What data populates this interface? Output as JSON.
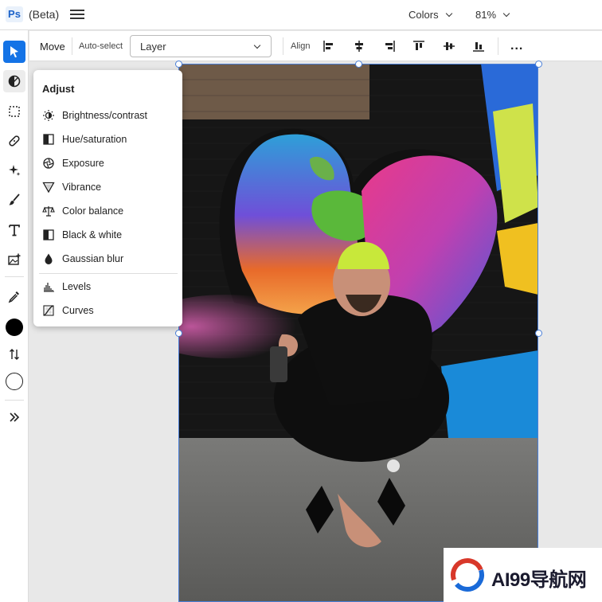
{
  "app": {
    "logo": "Ps",
    "channel": "(Beta)",
    "color_mode_dropdown": "Colors",
    "zoom_dropdown": "81%"
  },
  "toolbar_left": {
    "tools": [
      {
        "name": "move-tool-icon",
        "active": true
      },
      {
        "name": "adjustment-tool-icon",
        "active": false
      },
      {
        "name": "marquee-tool-icon",
        "active": false
      },
      {
        "name": "spot-healing-tool-icon",
        "active": false
      },
      {
        "name": "generative-fill-icon",
        "active": false
      },
      {
        "name": "brush-tool-icon",
        "active": false
      },
      {
        "name": "type-tool-icon",
        "active": false
      },
      {
        "name": "place-image-icon",
        "active": false
      },
      {
        "name": "eyedropper-icon",
        "active": false
      },
      {
        "name": "foreground-color-swatch",
        "active": false
      },
      {
        "name": "swap-colors-icon",
        "active": false
      },
      {
        "name": "background-color-swatch",
        "active": false
      },
      {
        "name": "expand-toolbar-icon",
        "active": false
      }
    ],
    "foreground_color": "#000000",
    "background_color": "#ffffff",
    "accent_color": "#1473e6"
  },
  "options_bar": {
    "tool_label": "Move",
    "auto_select_label": "Auto-select",
    "auto_select_value": "Layer",
    "align_label": "Align",
    "align_icons": [
      "align-left-icon",
      "align-horizontal-center-icon",
      "align-right-icon",
      "align-top-icon",
      "align-vertical-center-icon",
      "align-bottom-icon"
    ],
    "more_label": "..."
  },
  "adjust_panel": {
    "title": "Adjust",
    "items": [
      {
        "label": "Brightness/contrast",
        "icon": "brightness-icon"
      },
      {
        "label": "Hue/saturation",
        "icon": "hue-saturation-icon"
      },
      {
        "label": "Exposure",
        "icon": "exposure-icon"
      },
      {
        "label": "Vibrance",
        "icon": "vibrance-icon"
      },
      {
        "label": "Color balance",
        "icon": "color-balance-icon"
      },
      {
        "label": "Black & white",
        "icon": "black-white-icon"
      },
      {
        "label": "Gaussian blur",
        "icon": "gaussian-blur-icon"
      },
      {
        "label": "Levels",
        "icon": "levels-icon"
      },
      {
        "label": "Curves",
        "icon": "curves-icon"
      }
    ]
  },
  "watermark": {
    "text": "AI99导航网"
  },
  "selection_color": "#4a7fd8"
}
